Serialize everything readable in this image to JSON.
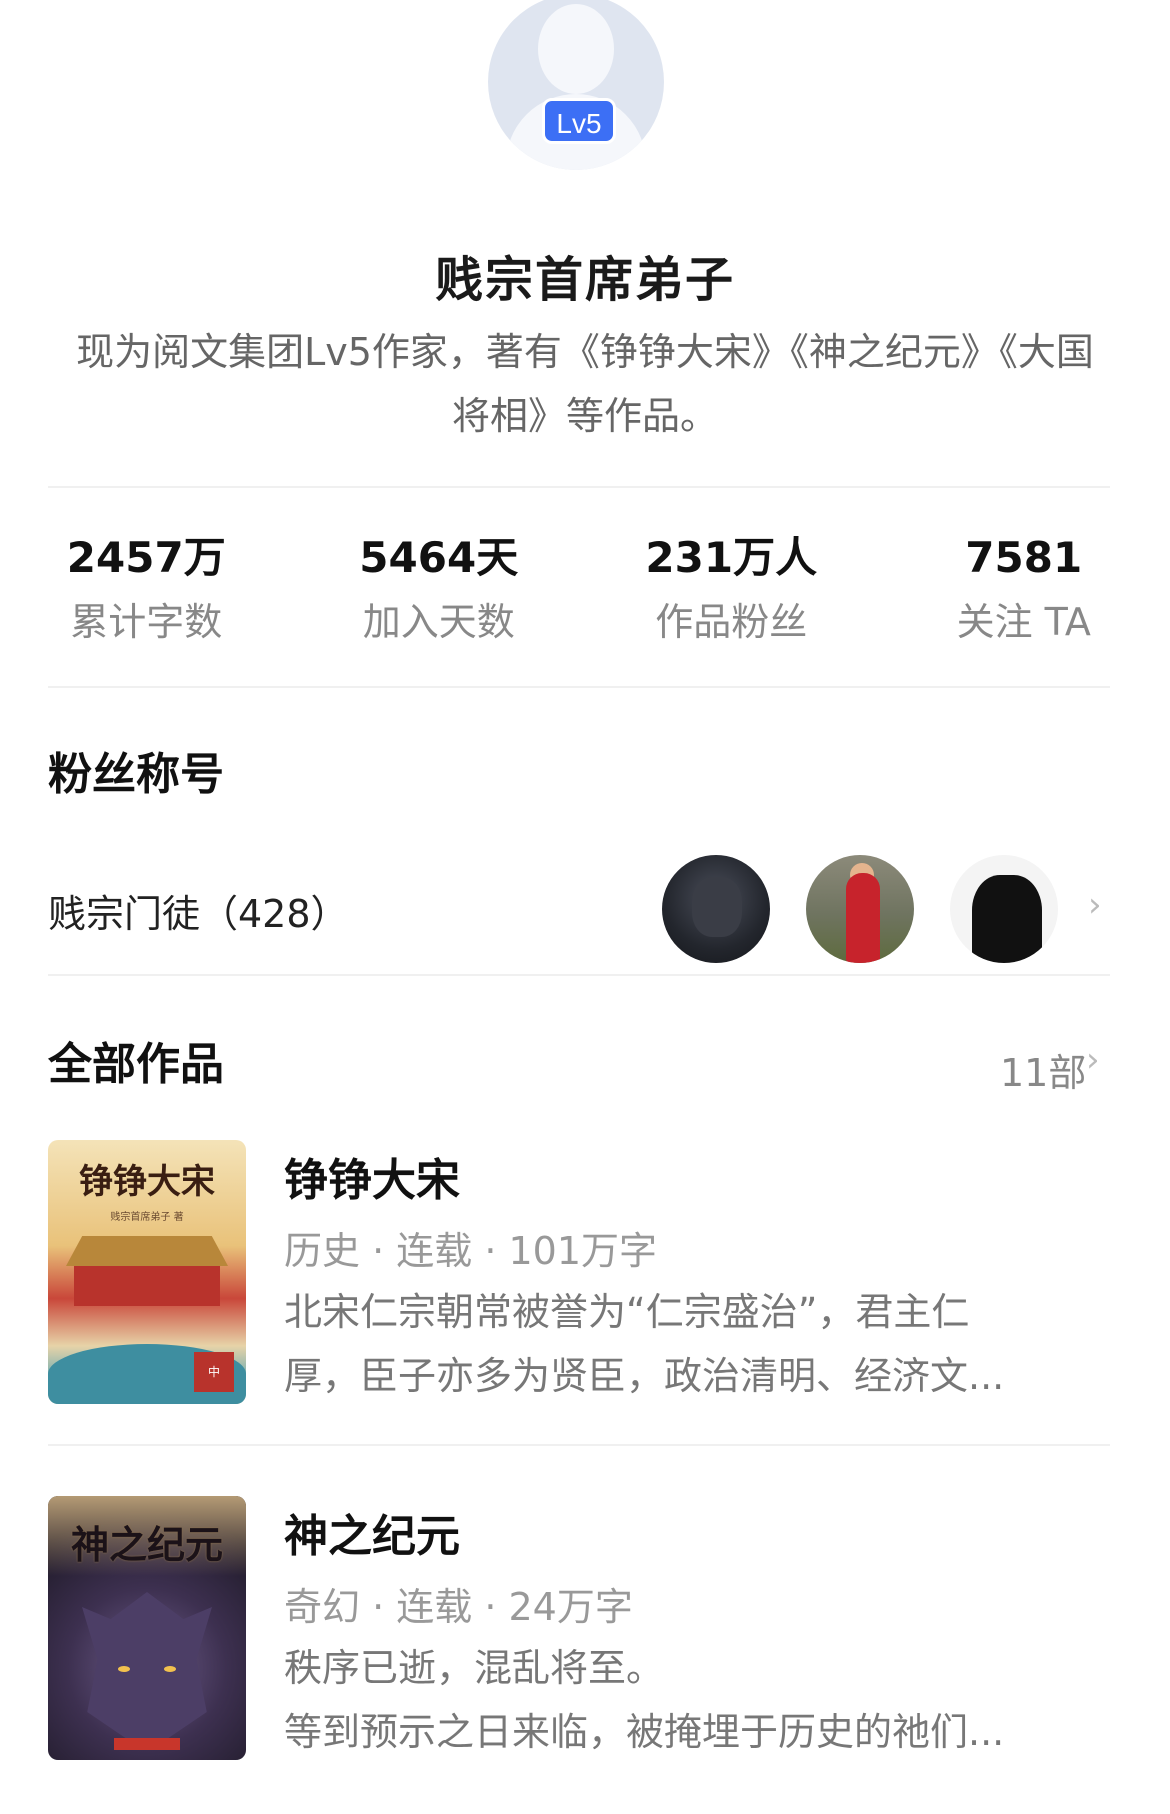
{
  "profile": {
    "level_badge": "Lv5",
    "name": "贱宗首席弟子",
    "bio": "现为阅文集团Lv5作家，著有《铮铮大宋》《神之纪元》《大国将相》等作品。"
  },
  "stats": [
    {
      "value": "2457万",
      "label": "累计字数"
    },
    {
      "value": "5464天",
      "label": "加入天数"
    },
    {
      "value": "231万人",
      "label": "作品粉丝"
    },
    {
      "value": "7581",
      "label": "关注 TA"
    }
  ],
  "fan_title": {
    "section_title": "粉丝称号",
    "label": "贱宗门徒（428）",
    "chevron": "›"
  },
  "works": {
    "section_title": "全部作品",
    "count": "11部",
    "chevron": "›",
    "books": [
      {
        "cover_title": "铮铮大宋",
        "cover_subtitle": "贱宗首席弟子 著",
        "cover_seal": "中",
        "title": "铮铮大宋",
        "meta": "历史 · 连载 · 101万字",
        "desc_line1": "北宋仁宗朝常被誉为“仁宗盛治”，君主仁",
        "desc_line2": "厚，臣子亦多为贤臣，政治清明、经济文..."
      },
      {
        "cover_title": "神之纪元",
        "title": "神之纪元",
        "meta": "奇幻 · 连载 · 24万字",
        "desc_line1": "秩序已逝，混乱将至。",
        "desc_line2": "等到预示之日来临，被掩埋于历史的祂们..."
      }
    ]
  }
}
